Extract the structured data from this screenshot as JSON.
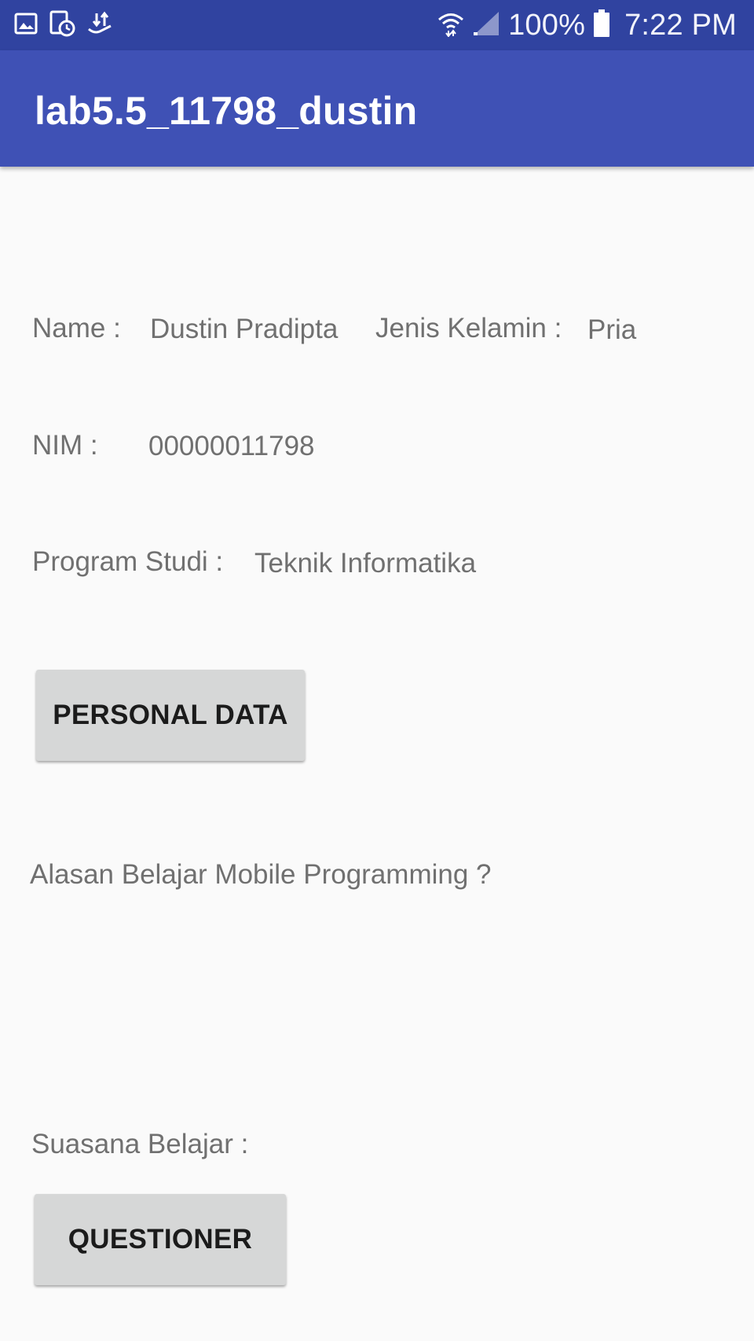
{
  "status_bar": {
    "icons_left": [
      "gallery-icon",
      "screenshot-clock-icon",
      "data-transfer-icon"
    ],
    "wifi_icon": "wifi-icon",
    "signal_icon": "signal-icon",
    "battery_percent": "100%",
    "battery_icon": "battery-icon",
    "time": "7:22 PM"
  },
  "app_bar": {
    "title": "lab5.5_11798_dustin",
    "color": "#3f51b5",
    "status_color": "#3043a0"
  },
  "profile": {
    "name_label": "Name :",
    "name_value": "Dustin Pradipta",
    "gender_label": "Jenis Kelamin :",
    "gender_value": "Pria",
    "nim_label": "NIM :",
    "nim_value": "00000011798",
    "program_label": "Program Studi :",
    "program_value": "Teknik Informatika"
  },
  "buttons": {
    "personal_data": "PERSONAL DATA",
    "questioner": "QUESTIONER"
  },
  "questions": {
    "reason_label": "Alasan Belajar Mobile Programming ?",
    "atmosphere_label": "Suasana Belajar :"
  }
}
